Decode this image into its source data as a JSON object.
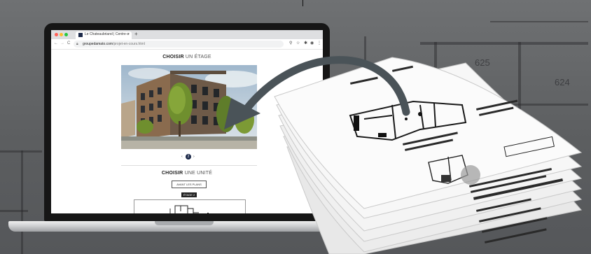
{
  "browser": {
    "tab_title": "Le Chateaubriand | Centre-s",
    "tab_close": "×",
    "new_tab": "+",
    "nav_back": "←",
    "nav_forward": "→",
    "nav_reload": "C",
    "url_domain": "groupedamato.com",
    "url_path": "/projet-en-cours.html"
  },
  "page": {
    "floor_heading_bold": "CHOISIR",
    "floor_heading_light": "UN ÉTAGE",
    "pager_prev": "‹",
    "pager_current": "2",
    "pager_next": "›",
    "unit_heading_bold": "CHOISIR",
    "unit_heading_light": "UNE UNITÉ",
    "plans_button": "AVANT LES PLANS",
    "floor_tag": "ÉTAGE 2"
  },
  "background": {
    "plan_labels": [
      "625",
      "624"
    ]
  },
  "colors": {
    "background": "#5f6163",
    "laptop_frame": "#161616",
    "arrow": "#4a5358",
    "page_accent": "#1d2a4a"
  }
}
